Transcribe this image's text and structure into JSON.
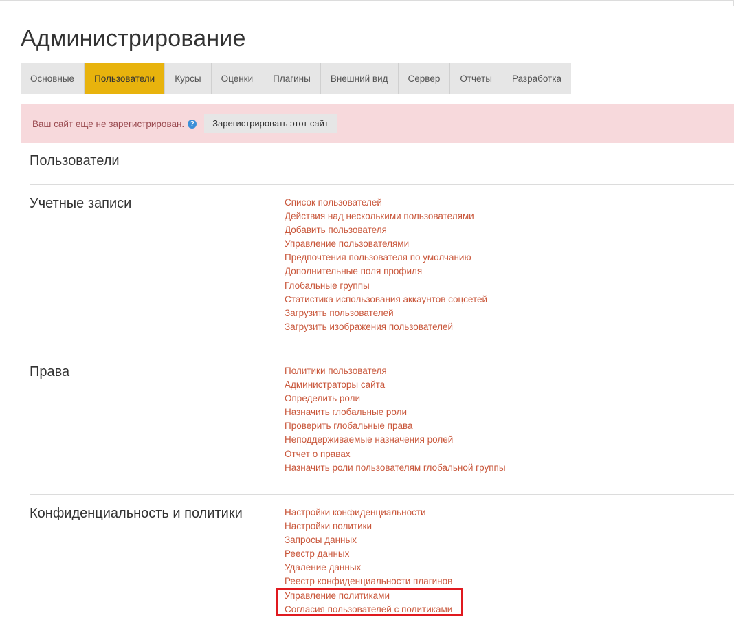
{
  "page_title": "Администрирование",
  "tabs": [
    {
      "label": "Основные",
      "active": false
    },
    {
      "label": "Пользователи",
      "active": true
    },
    {
      "label": "Курсы",
      "active": false
    },
    {
      "label": "Оценки",
      "active": false
    },
    {
      "label": "Плагины",
      "active": false
    },
    {
      "label": "Внешний вид",
      "active": false
    },
    {
      "label": "Сервер",
      "active": false
    },
    {
      "label": "Отчеты",
      "active": false
    },
    {
      "label": "Разработка",
      "active": false
    }
  ],
  "alert": {
    "text": "Ваш сайт еще не зарегистрирован.",
    "help_icon": "question-circle-icon",
    "help_glyph": "?",
    "button_label": "Зарегистрировать этот сайт"
  },
  "section_heading": "Пользователи",
  "groups": [
    {
      "title": "Учетные записи",
      "links": [
        "Список пользователей",
        "Действия над несколькими пользователями",
        "Добавить пользователя",
        "Управление пользователями",
        "Предпочтения пользователя по умолчанию",
        "Дополнительные поля профиля",
        "Глобальные группы",
        "Статистика использования аккаунтов соцсетей",
        "Загрузить пользователей",
        "Загрузить изображения пользователей"
      ]
    },
    {
      "title": "Права",
      "links": [
        "Политики пользователя",
        "Администраторы сайта",
        "Определить роли",
        "Назначить глобальные роли",
        "Проверить глобальные права",
        "Неподдерживаемые назначения ролей",
        "Отчет о правах",
        "Назначить роли пользователям глобальной группы"
      ]
    },
    {
      "title": "Конфиденциальность и политики",
      "links": [
        "Настройки конфиденциальности",
        "Настройки политики",
        "Запросы данных",
        "Реестр данных",
        "Удаление данных",
        "Реестр конфиденциальности плагинов",
        "Управление политиками",
        "Согласия пользователей с политиками"
      ]
    }
  ],
  "colors": {
    "accent_tab": "#e8b30d",
    "link": "#c9573b",
    "alert_bg": "#f7d9dc",
    "highlight_border": "#e0191f"
  }
}
